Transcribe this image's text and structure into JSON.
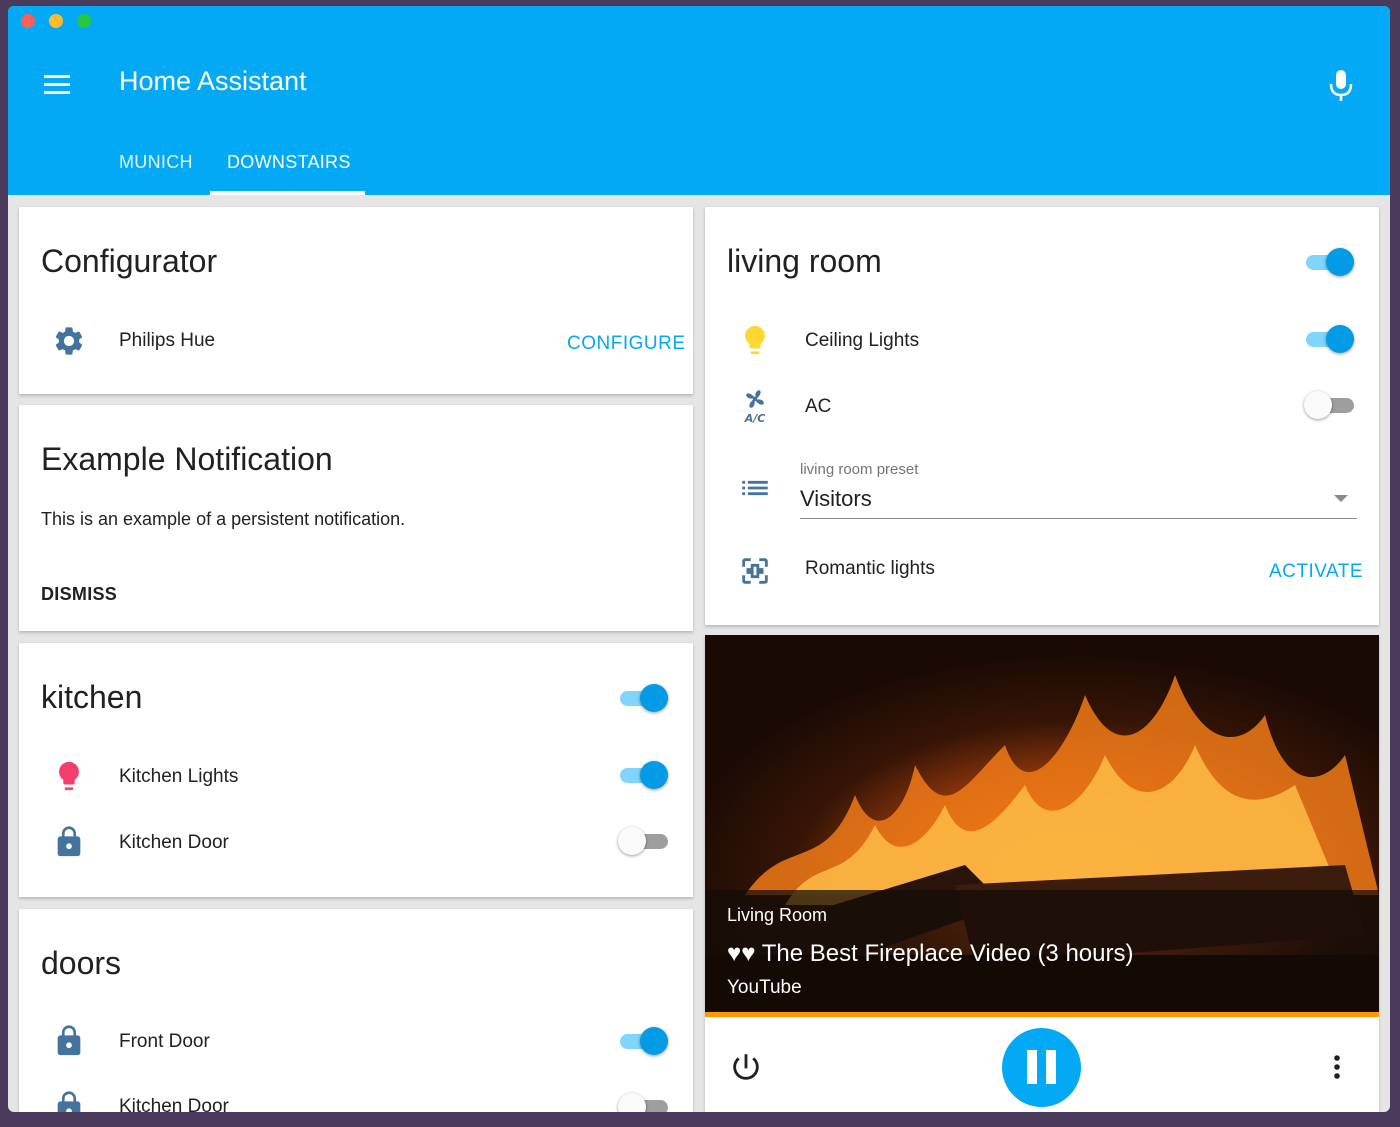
{
  "app": {
    "title": "Home Assistant",
    "tabs": [
      {
        "label": "MUNICH"
      },
      {
        "label": "DOWNSTAIRS"
      }
    ]
  },
  "configurator": {
    "title": "Configurator",
    "item_label": "Philips Hue",
    "action": "CONFIGURE"
  },
  "notification": {
    "title": "Example Notification",
    "message": "This is an example of a persistent notification.",
    "dismiss": "DISMISS"
  },
  "kitchen": {
    "title": "kitchen",
    "group_on": true,
    "rows": [
      {
        "label": "Kitchen Lights",
        "on": true
      },
      {
        "label": "Kitchen Door",
        "on": false
      }
    ]
  },
  "doors": {
    "title": "doors",
    "group_on": true,
    "rows": [
      {
        "label": "Front Door",
        "on": true
      },
      {
        "label": "Kitchen Door",
        "on": false
      }
    ]
  },
  "living_room": {
    "title": "living room",
    "group_on": true,
    "rows": [
      {
        "label": "Ceiling Lights",
        "on": true
      },
      {
        "label": "AC",
        "on": false
      }
    ],
    "preset": {
      "label": "living room preset",
      "value": "Visitors"
    },
    "scene": {
      "label": "Romantic lights",
      "action": "ACTIVATE"
    }
  },
  "media": {
    "source": "Living Room",
    "title": "♥♥ The Best Fireplace Video (3 hours)",
    "app_name": "YouTube"
  },
  "colors": {
    "primary": "#03a9f4",
    "toggle_on": "#039be5",
    "icon_blue": "#44739e",
    "bulb_yellow": "#fdd835",
    "bulb_pink": "#f43f6e",
    "progress": "#ff9800"
  }
}
